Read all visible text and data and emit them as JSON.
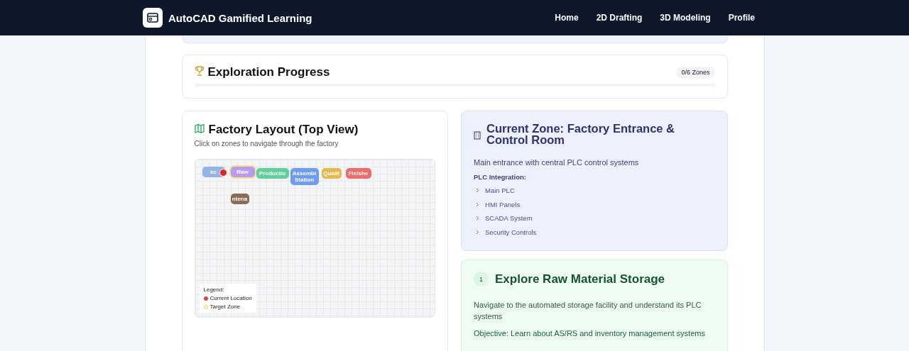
{
  "navbar": {
    "title": "AutoCAD Gamified Learning",
    "links": [
      "Home",
      "2D Drafting",
      "3D Modeling",
      "Profile"
    ]
  },
  "progress": {
    "title": "Exploration Progress",
    "badge": "0/6 Zones",
    "level": 0
  },
  "layout": {
    "title": "Factory Layout (Top View)",
    "subtitle": "Click on zones to navigate through the factory",
    "zones": [
      {
        "label": "ac",
        "color": "#93b4e8",
        "current": true,
        "target": false
      },
      {
        "label": "Raw",
        "color": "#b79cf0",
        "current": false,
        "target": true
      },
      {
        "label": "Productio",
        "color": "#5fcf9c",
        "current": false,
        "target": false
      },
      {
        "label": "Assembl Station",
        "color": "#6f9cf0",
        "current": false,
        "target": false
      },
      {
        "label": "Qualit",
        "color": "#e9b84c",
        "current": false,
        "target": false
      },
      {
        "label": "Finishe",
        "color": "#ee6b6b",
        "current": false,
        "target": false
      },
      {
        "label": "ntena",
        "color": "#8a6b55",
        "current": false,
        "target": false
      }
    ],
    "legend": {
      "title": "Legend:",
      "items": [
        {
          "kind": "current",
          "label": "Current Location"
        },
        {
          "kind": "target",
          "label": "Target Zone"
        }
      ]
    }
  },
  "current_zone": {
    "title": "Current Zone: Factory Entrance & Control Room",
    "description": "Main entrance with central PLC control systems",
    "list_title": "PLC Integration:",
    "items": [
      "Main PLC",
      "HMI Panels",
      "SCADA System",
      "Security Controls"
    ]
  },
  "task": {
    "number": "1",
    "title": "Explore Raw Material Storage",
    "description": "Navigate to the automated storage facility and understand its PLC systems",
    "objective": "Objective: Learn about AS/RS and inventory management systems"
  }
}
